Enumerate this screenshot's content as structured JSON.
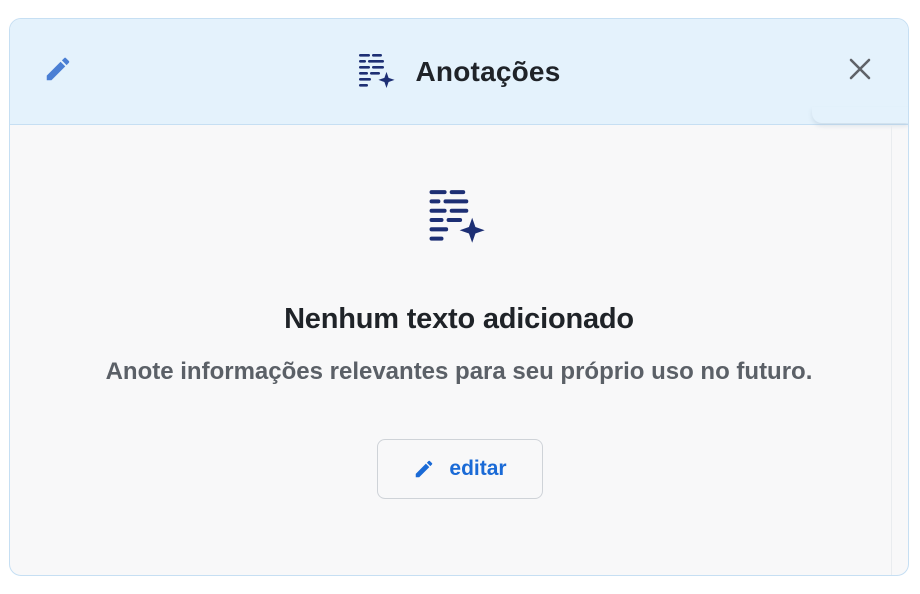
{
  "header": {
    "title": "Anotações",
    "edit_icon": "pencil-icon",
    "title_icon": "notes-sparkle-icon",
    "close_icon": "close-icon"
  },
  "empty_state": {
    "icon": "notes-sparkle-icon",
    "title": "Nenhum texto adicionado",
    "subtitle": "Anote informações relevantes para seu próprio uso no futuro."
  },
  "edit_button": {
    "label": "editar",
    "icon": "pencil-icon"
  },
  "colors": {
    "accent": "#1a6ad6",
    "icon_navy": "#1d2f74",
    "pencil_blue": "#4a7fd4",
    "header_bg": "#e4f2fc",
    "panel_bg": "#f8f8f9"
  }
}
